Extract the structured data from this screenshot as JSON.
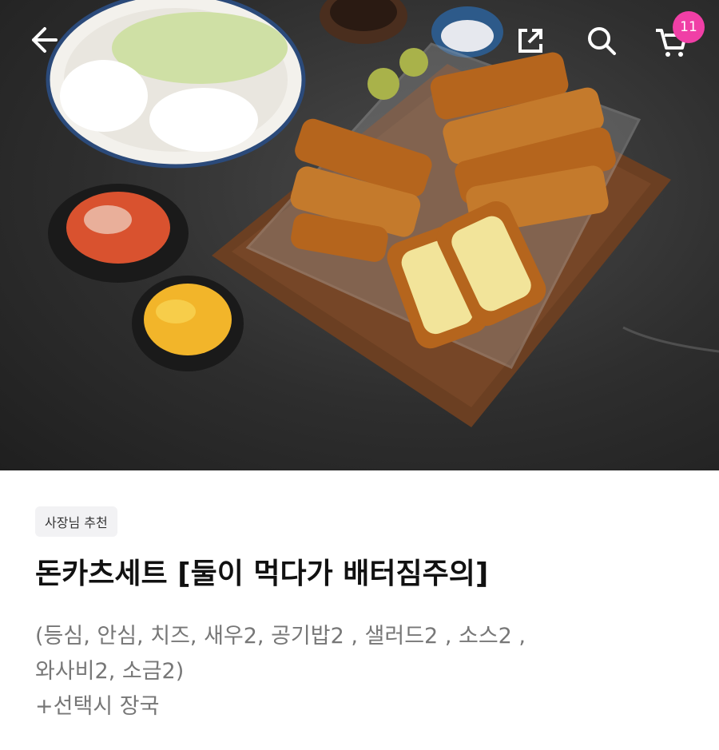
{
  "header": {
    "back_icon": "arrow-left-icon",
    "share_icon": "share-icon",
    "search_icon": "search-icon",
    "cart_icon": "cart-icon",
    "cart_count": "11",
    "badge_color": "#f03fa6"
  },
  "product": {
    "badge": "사장님 추천",
    "title": "돈카츠세트 [둘이 먹다가 배터짐주의]",
    "description_line1": "(등심, 안심, 치즈, 새우2, 공기밥2 , 샐러드2 , 소스2 ,",
    "description_line2": "와사비2, 소금2)",
    "description_line3": "+선택시 장국"
  }
}
